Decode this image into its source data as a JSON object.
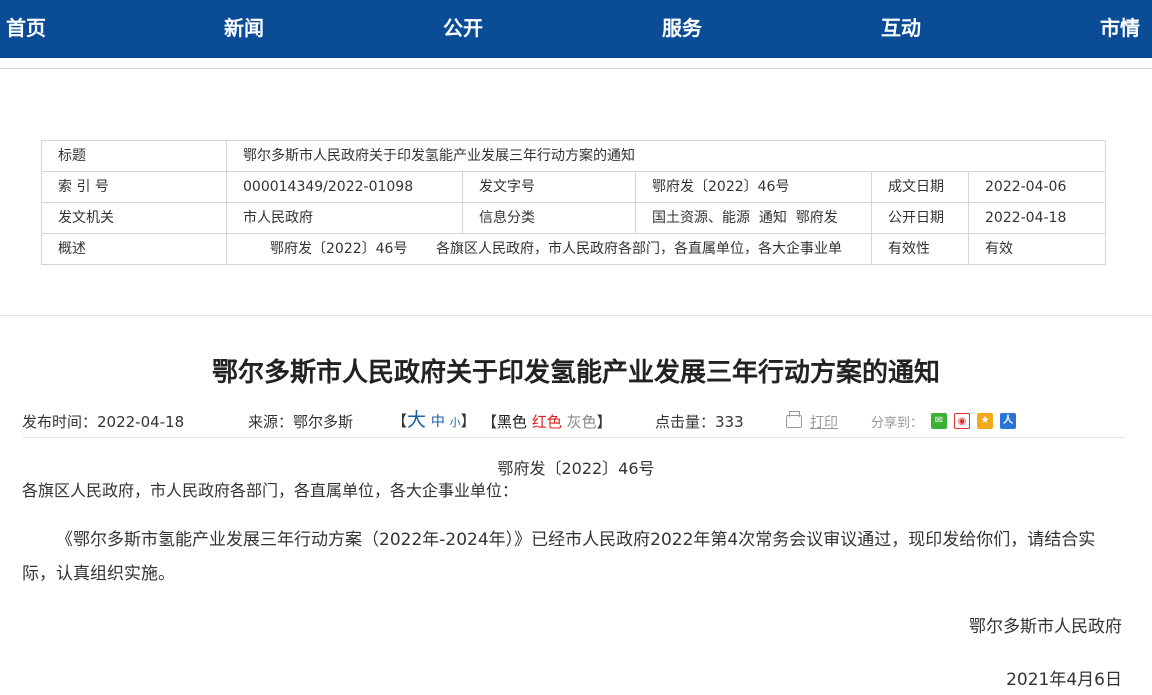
{
  "nav": {
    "items": [
      "首页",
      "新闻",
      "公开",
      "服务",
      "互动",
      "市情"
    ]
  },
  "meta": {
    "title_label": "标题",
    "title_value": "鄂尔多斯市人民政府关于印发氢能产业发展三年行动方案的通知",
    "index_label": "索 引 号",
    "index_value": "000014349/2022-01098",
    "docno_label": "发文字号",
    "docno_value": "鄂府发〔2022〕46号",
    "made_label": "成文日期",
    "made_value": "2022-04-06",
    "issuer_label": "发文机关",
    "issuer_value": "市人民政府",
    "cat_label": "信息分类",
    "cat_value": "国土资源、能源  通知  鄂府发",
    "pub_label": "公开日期",
    "pub_value": "2022-04-18",
    "summary_label": "概述",
    "summary_docno": "鄂府发〔2022〕46号",
    "summary_value": "各旗区人民政府，市人民政府各部门，各直属单位，各大企事业单",
    "valid_label": "有效性",
    "valid_value": "有效"
  },
  "article": {
    "title": "鄂尔多斯市人民政府关于印发氢能产业发展三年行动方案的通知",
    "publish_time": "发布时间：2022-04-18",
    "source": "来源：鄂尔多斯",
    "font_open": "【",
    "font_big": "大",
    "font_mid": "中",
    "font_small": "小",
    "font_close": "】",
    "color_open": "【",
    "color_black": "黑色",
    "color_red": "红色",
    "color_gray": "灰色",
    "color_close": "】",
    "hits": "点击量：333",
    "print": "打印",
    "share": "分享到："
  },
  "content": {
    "doc_no": "鄂府发〔2022〕46号",
    "recipients": "各旗区人民政府，市人民政府各部门，各直属单位，各大企事业单位：",
    "paragraph": "《鄂尔多斯市氢能产业发展三年行动方案（2022年-2024年）》已经市人民政府2022年第4次常务会议审议通过，现印发给你们，请结合实际，认真组织实施。",
    "signature": "鄂尔多斯市人民政府",
    "date": "2021年4月6日"
  },
  "colors": {
    "nav_bg": "#0a4d96",
    "link_blue": "#1a5ea8",
    "red": "#e02020"
  }
}
